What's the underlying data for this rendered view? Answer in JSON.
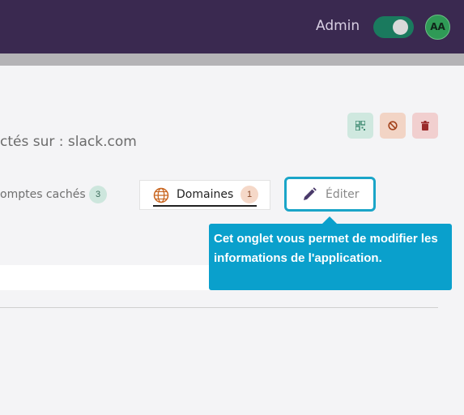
{
  "header": {
    "role_label": "Admin",
    "toggle_on": true,
    "avatar_initials": "AA"
  },
  "colors": {
    "header_bg": "#3a2950",
    "accent": "#1aa5c8",
    "toggle_on": "#1a7a5e",
    "avatar": "#2f9a56"
  },
  "actions": [
    {
      "name": "qr-code",
      "color": "#cfe8df"
    },
    {
      "name": "block",
      "color": "#f2d4c5"
    },
    {
      "name": "delete",
      "color": "#f1cfcf"
    }
  ],
  "app": {
    "subtitle": "ctés sur : slack.com"
  },
  "tabs": {
    "hidden_accounts": {
      "label": "omptes cachés",
      "count": "3"
    },
    "domains": {
      "label": "Domaines",
      "count": "1",
      "icon": "globe-icon"
    },
    "edit": {
      "label": "Éditer",
      "icon": "pencil-icon"
    }
  },
  "tooltip": {
    "text": "Cet onglet vous permet de modifier les informations de l'application."
  }
}
